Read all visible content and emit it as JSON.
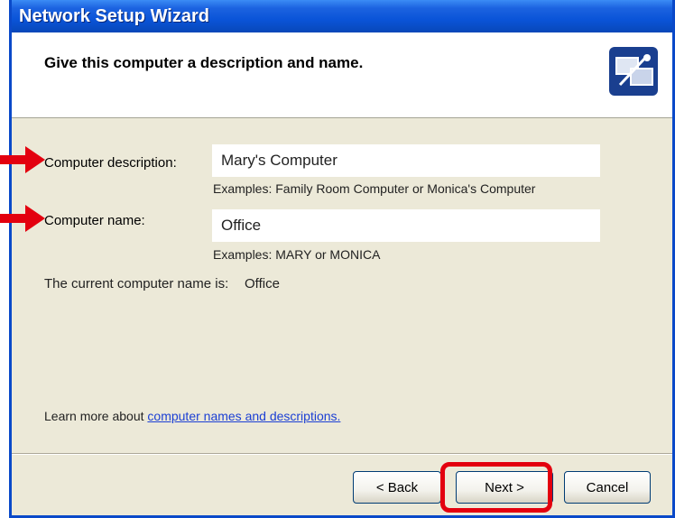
{
  "window": {
    "title": "Network Setup Wizard"
  },
  "header": {
    "heading": "Give this computer a description and name.",
    "icon": "network-wizard-icon"
  },
  "fields": {
    "description": {
      "label": "Computer description:",
      "value": "Mary's Computer",
      "example": "Examples: Family Room Computer or Monica's Computer"
    },
    "name": {
      "label": "Computer name:",
      "value": "Office",
      "example": "Examples: MARY or MONICA"
    }
  },
  "current_name": {
    "label": "The current computer name is:",
    "value": "Office"
  },
  "learn_more": {
    "prefix": "Learn more about ",
    "link": "computer names and descriptions."
  },
  "buttons": {
    "back": "< Back",
    "next": "Next >",
    "cancel": "Cancel"
  },
  "colors": {
    "title_bar": "#0a54d8",
    "annotation_red": "#e3000f",
    "link": "#1b3fd4"
  }
}
